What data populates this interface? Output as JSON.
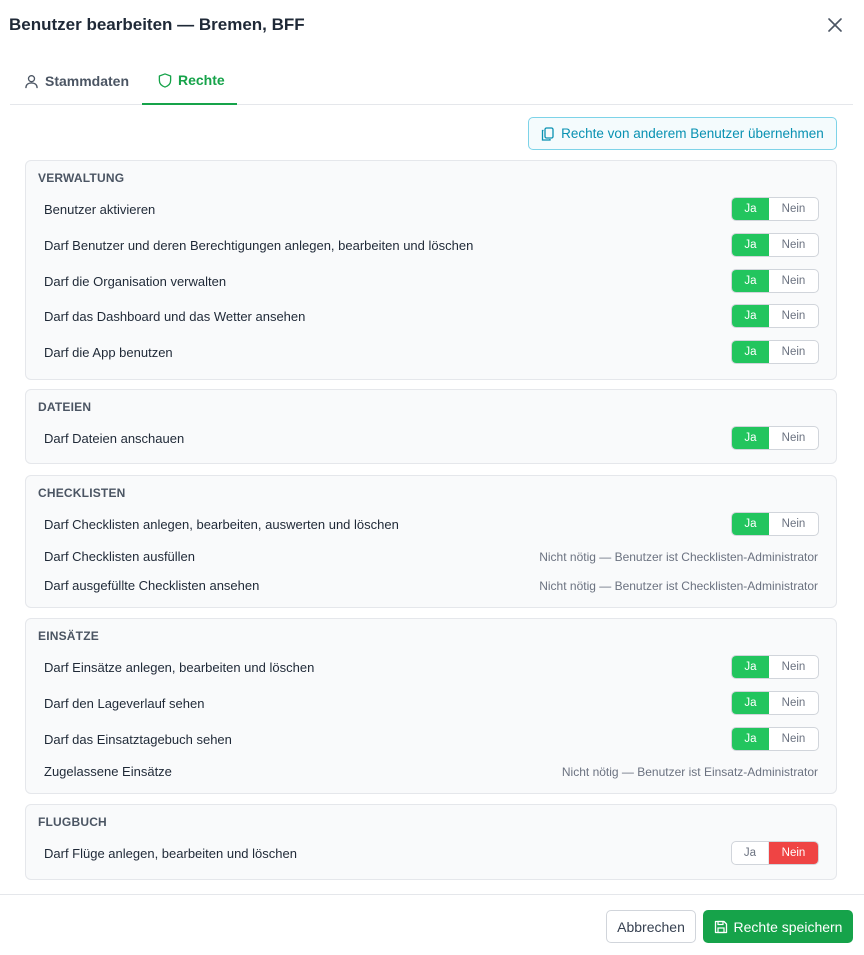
{
  "dialog": {
    "title": "Benutzer bearbeiten — Bremen, BFF",
    "close_icon": "close-icon"
  },
  "tabs": [
    {
      "label": "Stammdaten",
      "icon": "user-icon",
      "active": false
    },
    {
      "label": "Rechte",
      "icon": "shield-icon",
      "active": true
    }
  ],
  "copy_button": {
    "label": "Rechte von anderem Benutzer übernehmen",
    "icon": "copy-icon"
  },
  "toggle_labels": {
    "yes": "Ja",
    "no": "Nein"
  },
  "colors": {
    "accent": "#16a34a",
    "yes_on": "#22c55e",
    "no_on": "#ef4444",
    "info": "#0891b2"
  },
  "sections": [
    {
      "title": "VERWALTUNG",
      "rows": [
        {
          "label": "Benutzer aktivieren",
          "value": "Ja"
        },
        {
          "label": "Darf Benutzer und deren Berechtigungen anlegen, bearbeiten und löschen",
          "value": "Ja"
        },
        {
          "label": "Darf die Organisation verwalten",
          "value": "Ja"
        },
        {
          "label": "Darf das Dashboard und das Wetter ansehen",
          "value": "Ja"
        },
        {
          "label": "Darf die App benutzen",
          "value": "Ja"
        }
      ]
    },
    {
      "title": "DATEIEN",
      "rows": [
        {
          "label": "Darf Dateien anschauen",
          "value": "Ja"
        }
      ]
    },
    {
      "title": "CHECKLISTEN",
      "rows": [
        {
          "label": "Darf Checklisten anlegen, bearbeiten, auswerten und löschen",
          "value": "Ja"
        },
        {
          "label": "Darf Checklisten ausfüllen",
          "note": "Nicht nötig — Benutzer ist Checklisten-Administrator"
        },
        {
          "label": "Darf ausgefüllte Checklisten ansehen",
          "note": "Nicht nötig — Benutzer ist Checklisten-Administrator"
        }
      ]
    },
    {
      "title": "EINSÄTZE",
      "rows": [
        {
          "label": "Darf Einsätze anlegen, bearbeiten und löschen",
          "value": "Ja"
        },
        {
          "label": "Darf den Lageverlauf sehen",
          "value": "Ja"
        },
        {
          "label": "Darf das Einsatztagebuch sehen",
          "value": "Ja"
        },
        {
          "label": "Zugelassene Einsätze",
          "note": "Nicht nötig — Benutzer ist Einsatz-Administrator"
        }
      ]
    },
    {
      "title": "FLUGBUCH",
      "rows": [
        {
          "label": "Darf Flüge anlegen, bearbeiten und löschen",
          "value": "Nein"
        }
      ]
    }
  ],
  "footer": {
    "cancel_label": "Abbrechen",
    "save_label": "Rechte speichern",
    "save_icon": "save-icon"
  }
}
